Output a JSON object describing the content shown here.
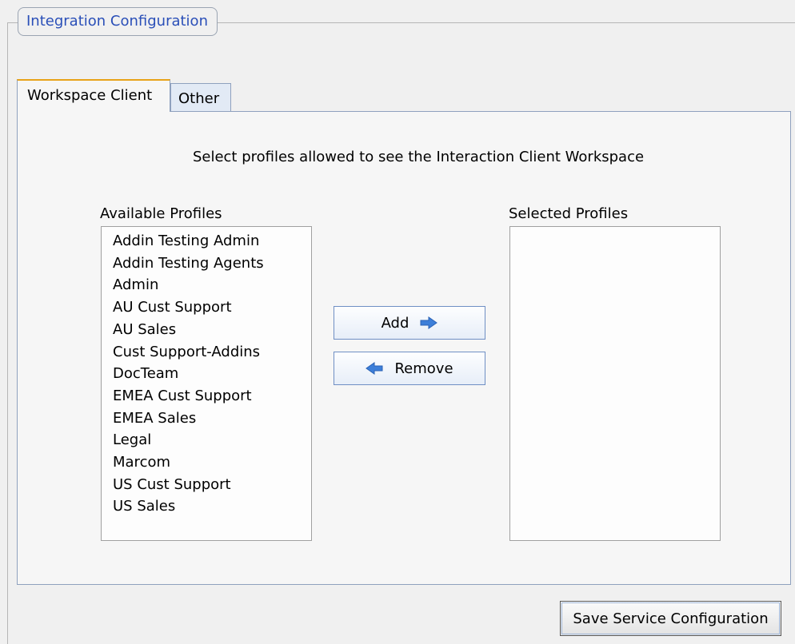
{
  "fieldset": {
    "legend": "Integration Configuration"
  },
  "tabs": [
    {
      "label": "Workspace Client",
      "active": true
    },
    {
      "label": "Other",
      "active": false
    }
  ],
  "panel": {
    "instruction": "Select profiles allowed to see the Interaction Client Workspace",
    "available_label": "Available Profiles",
    "selected_label": "Selected Profiles",
    "available_profiles": [
      "Addin Testing Admin",
      "Addin Testing Agents",
      "Admin",
      "AU Cust Support",
      "AU Sales",
      "Cust Support-Addins",
      "DocTeam",
      "EMEA Cust Support",
      "EMEA Sales",
      "Legal",
      "Marcom",
      "US Cust Support",
      "US Sales"
    ],
    "selected_profiles": [],
    "add_label": "Add",
    "remove_label": "Remove"
  },
  "footer": {
    "save_label": "Save Service Configuration"
  },
  "icons": {
    "add": "arrow-right-icon",
    "remove": "arrow-left-icon"
  },
  "colors": {
    "legend_text": "#2a4fb8",
    "active_tab_accent": "#e8a318",
    "arrow_fill": "#3d7fd9"
  }
}
